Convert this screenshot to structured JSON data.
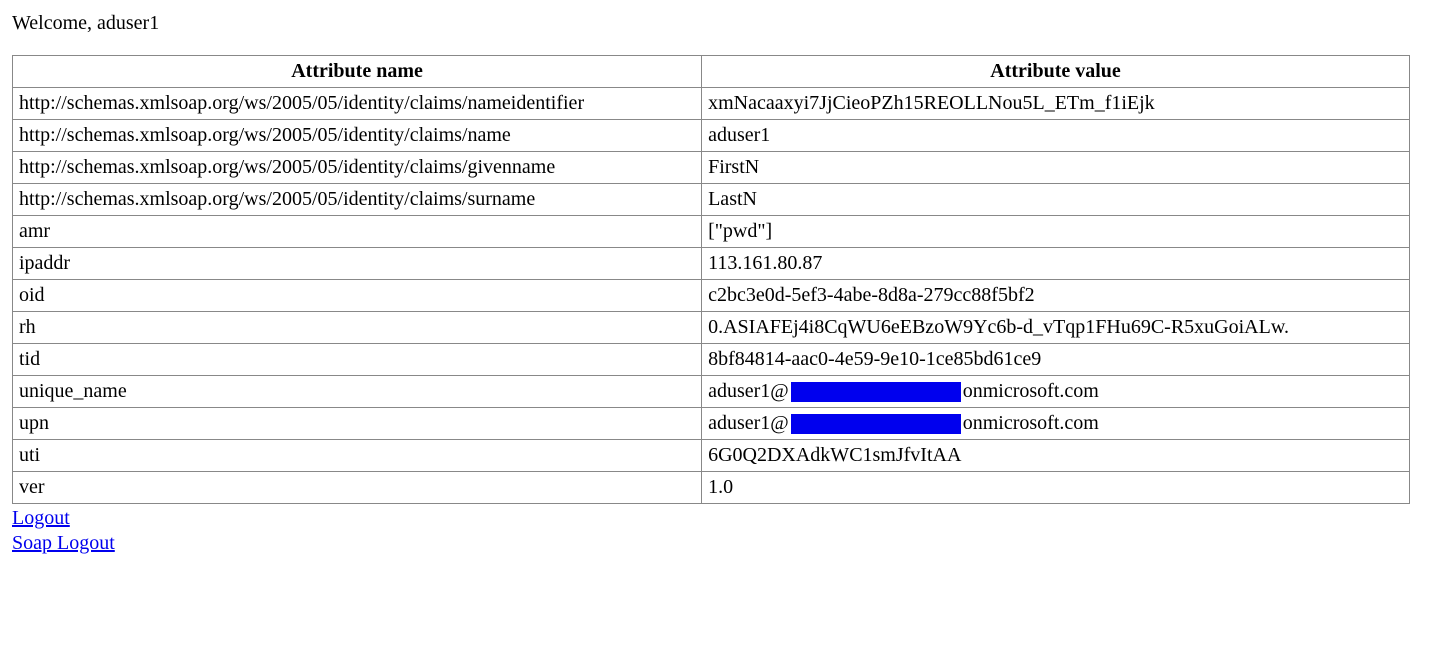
{
  "welcome": "Welcome, aduser1",
  "table": {
    "headers": {
      "name": "Attribute name",
      "value": "Attribute value"
    },
    "rows": [
      {
        "name": "http://schemas.xmlsoap.org/ws/2005/05/identity/claims/nameidentifier",
        "value": "xmNacaaxyi7JjCieoPZh15REOLLNou5L_ETm_f1iEjk"
      },
      {
        "name": "http://schemas.xmlsoap.org/ws/2005/05/identity/claims/name",
        "value": "aduser1"
      },
      {
        "name": "http://schemas.xmlsoap.org/ws/2005/05/identity/claims/givenname",
        "value": "FirstN"
      },
      {
        "name": "http://schemas.xmlsoap.org/ws/2005/05/identity/claims/surname",
        "value": "LastN"
      },
      {
        "name": "amr",
        "value": "[\"pwd\"]"
      },
      {
        "name": "ipaddr",
        "value": "113.161.80.87"
      },
      {
        "name": "oid",
        "value": "c2bc3e0d-5ef3-4abe-8d8a-279cc88f5bf2"
      },
      {
        "name": "rh",
        "value": "0.ASIAFEj4i8CqWU6eEBzoW9Yc6b-d_vTqp1FHu69C-R5xuGoiALw."
      },
      {
        "name": "tid",
        "value": "8bf84814-aac0-4e59-9e10-1ce85bd61ce9"
      },
      {
        "name": "unique_name",
        "redacted": true,
        "prefix": "aduser1@",
        "suffix": "onmicrosoft.com"
      },
      {
        "name": "upn",
        "redacted": true,
        "prefix": "aduser1@",
        "suffix": "onmicrosoft.com"
      },
      {
        "name": "uti",
        "value": "6G0Q2DXAdkWC1smJfvItAA"
      },
      {
        "name": "ver",
        "value": "1.0"
      }
    ]
  },
  "links": {
    "logout": "Logout",
    "soap_logout": "Soap Logout"
  }
}
